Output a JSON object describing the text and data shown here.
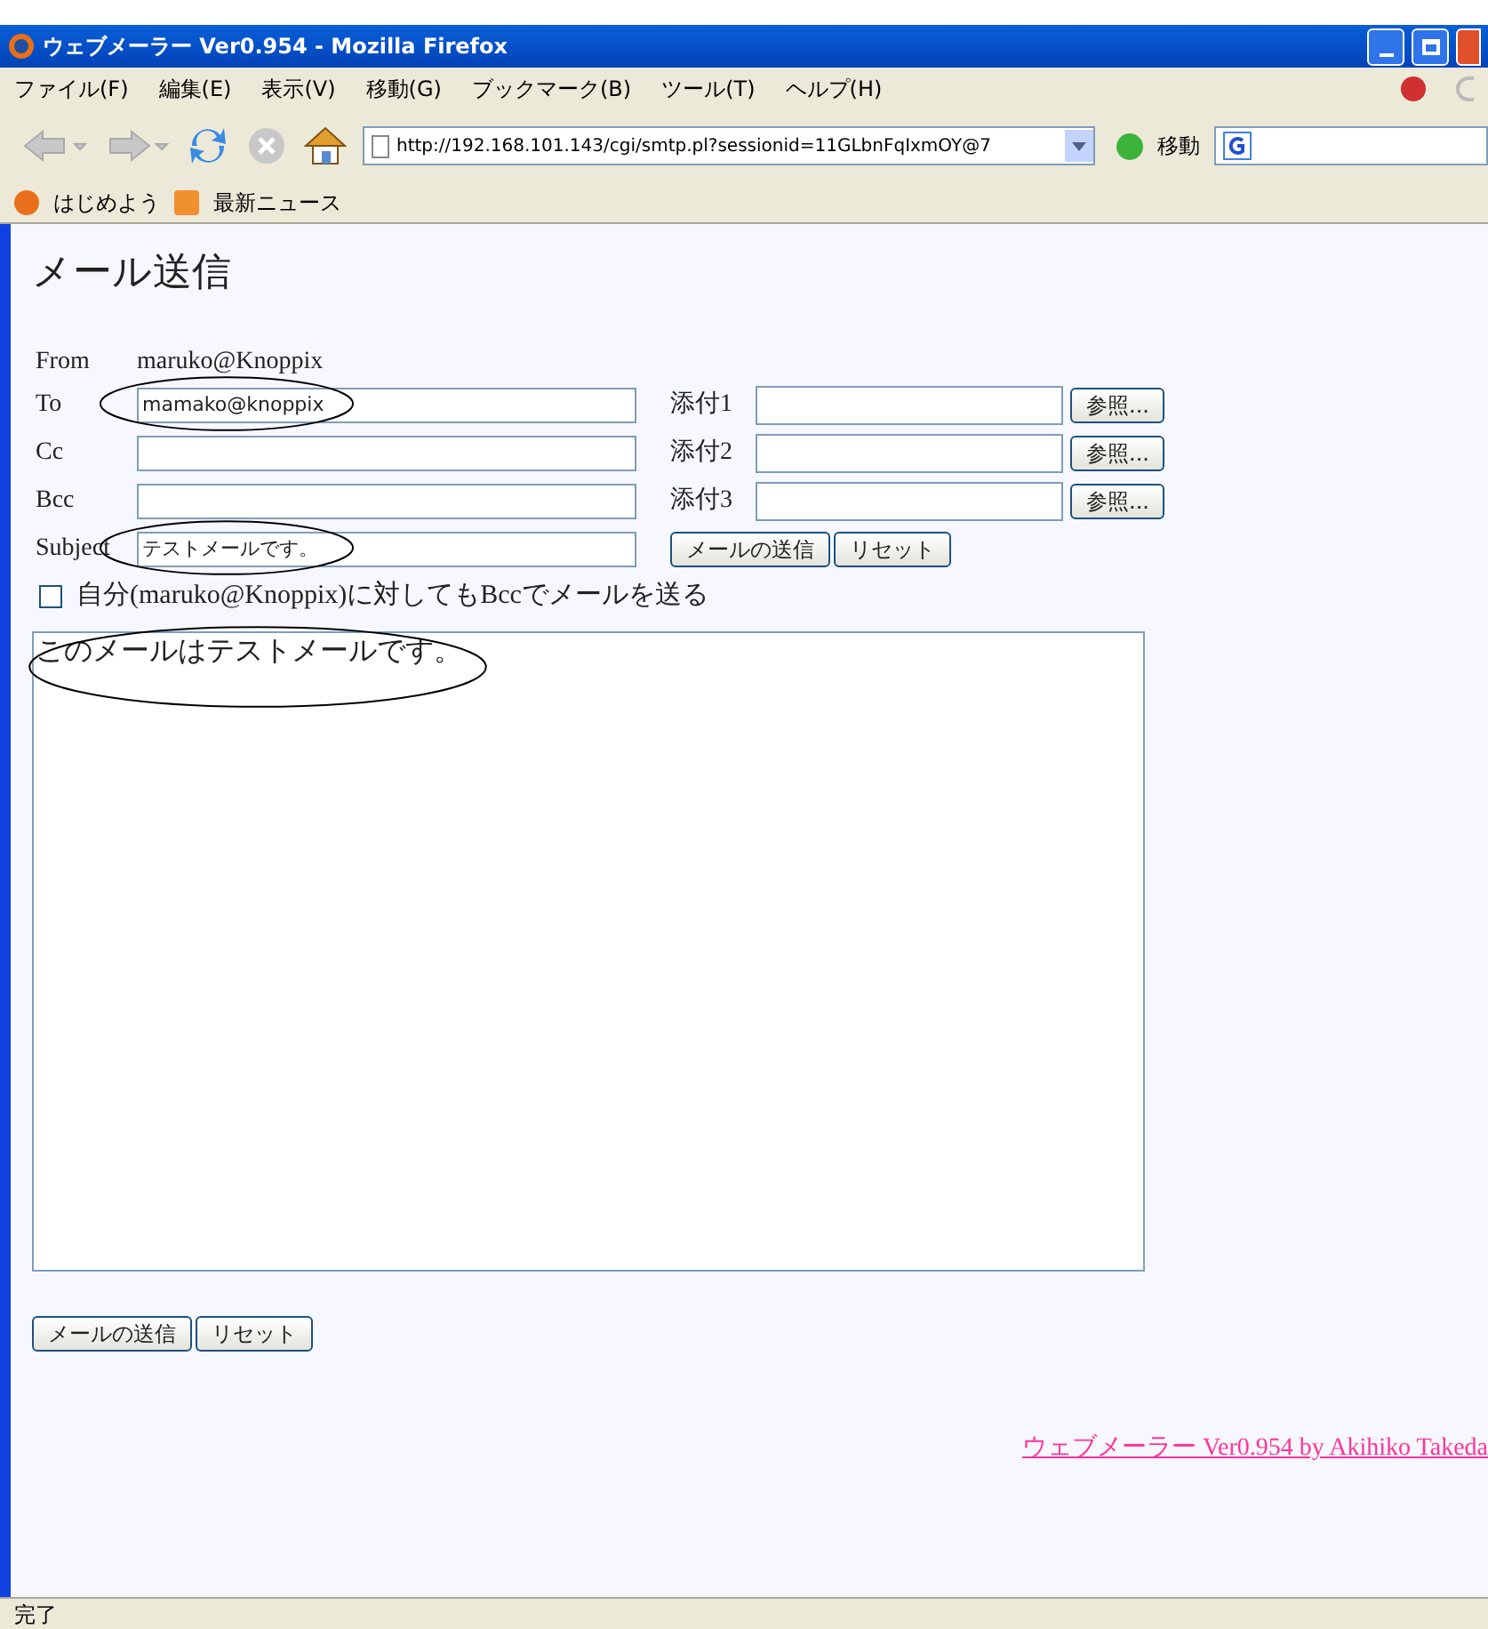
{
  "window": {
    "title": "ウェブメーラー Ver0.954 - Mozilla Firefox"
  },
  "menu": [
    "ファイル(F)",
    "編集(E)",
    "表示(V)",
    "移動(G)",
    "ブックマーク(B)",
    "ツール(T)",
    "ヘルプ(H)"
  ],
  "toolbar": {
    "url": "http://192.168.101.143/cgi/smtp.pl?sessionid=11GLbnFqIxmOY@7",
    "go": "移動"
  },
  "bookmarks": [
    "はじめよう",
    "最新ニュース"
  ],
  "page": {
    "heading": "メール送信",
    "from": {
      "label": "From",
      "value": "maruko@Knoppix"
    },
    "fields": [
      {
        "label": "To",
        "value": "mamako@knoppix",
        "circled": true
      },
      {
        "label": "Cc",
        "circled": false
      },
      {
        "label": "Bcc",
        "circled": false
      },
      {
        "label": "Subject",
        "value": "テストメールです。",
        "circled": true
      }
    ],
    "attachments": [
      {
        "label": "添付1",
        "button": "参照..."
      },
      {
        "label": "添付2",
        "button": "参照..."
      },
      {
        "label": "添付3",
        "button": "参照..."
      }
    ],
    "buttons": [
      "メールの送信",
      "リセット"
    ],
    "bcc_self": {
      "label": "自分(maruko@Knoppix)に対してもBccでメールを送る",
      "checked": false
    },
    "body": {
      "value": "このメールはテストメールです。",
      "circled": true
    },
    "bottom_buttons": [
      "メールの送信",
      "リセット"
    ],
    "footer_link": "ウェブメーラー Ver0.954 by Akihiko Takeda"
  },
  "status_bar": "完了"
}
